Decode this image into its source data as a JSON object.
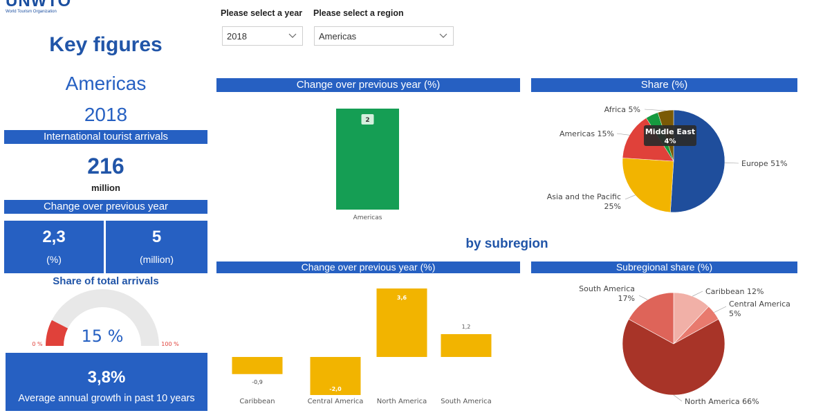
{
  "logo": {
    "name": "UNWTO",
    "subtitle": "World Tourism Organization"
  },
  "left_panel": {
    "title": "Key figures",
    "region": "Americas",
    "year": "2018",
    "arrivals_header": "International tourist arrivals",
    "arrivals_value": "216",
    "arrivals_unit": "million",
    "change_header": "Change over previous year",
    "change_pct_value": "2,3",
    "change_pct_unit": "(%)",
    "change_abs_value": "5",
    "change_abs_unit": "(million)",
    "share_title": "Share of total arrivals",
    "gauge": {
      "value": 15,
      "label": "15 %",
      "min_label": "0 %",
      "max_label": "100 %",
      "color": "#e0413a",
      "track_color": "#e8e8e8"
    },
    "avg_growth_value": "3,8%",
    "avg_growth_label": "Average annual growth in past 10 years"
  },
  "filters": {
    "year_label": "Please select a year",
    "year_value": "2018",
    "region_label": "Please select a region",
    "region_value": "Americas"
  },
  "subregion_title": "by subregion",
  "accent_color": "#2660c2",
  "chart_data": [
    {
      "id": "change-region",
      "type": "bar",
      "title": "Change over previous year (%)",
      "categories": [
        "Americas"
      ],
      "values": [
        2
      ],
      "data_labels": [
        "2"
      ],
      "color": "#159e54"
    },
    {
      "id": "share-region",
      "type": "pie",
      "title": "Share (%)",
      "labels": [
        "Europe",
        "Asia and the Pacific",
        "Americas",
        "Middle East",
        "Africa"
      ],
      "values": [
        51,
        25,
        15,
        4,
        5
      ],
      "label_texts": [
        "Europe 51%",
        "Asia and the Pacific 25%",
        "Americas 15%",
        "Middle East 4%",
        "Africa 5%"
      ],
      "colors": [
        "#1f4e9c",
        "#f2b400",
        "#e0413a",
        "#169a3f",
        "#7a5a06"
      ],
      "tooltip": {
        "title": "Middle East",
        "value": "4%"
      }
    },
    {
      "id": "change-subregion",
      "type": "bar",
      "title": "Change over previous year (%)",
      "categories": [
        "Caribbean",
        "Central America",
        "North America",
        "South America"
      ],
      "values": [
        -0.9,
        -2.0,
        3.6,
        1.2
      ],
      "data_labels": [
        "-0,9",
        "-2,0",
        "3,6",
        "1,2"
      ],
      "color": "#f2b400"
    },
    {
      "id": "subregion-share",
      "type": "pie",
      "title": "Subregional share (%)",
      "labels": [
        "Caribbean",
        "Central America",
        "North America",
        "South America"
      ],
      "values": [
        12,
        5,
        66,
        17
      ],
      "label_texts": [
        "Caribbean 12%",
        "Central America 5%",
        "North America 66%",
        "South America 17%"
      ],
      "colors": [
        "#f1b0a7",
        "#e87a6e",
        "#a83428",
        "#de6459"
      ]
    }
  ]
}
